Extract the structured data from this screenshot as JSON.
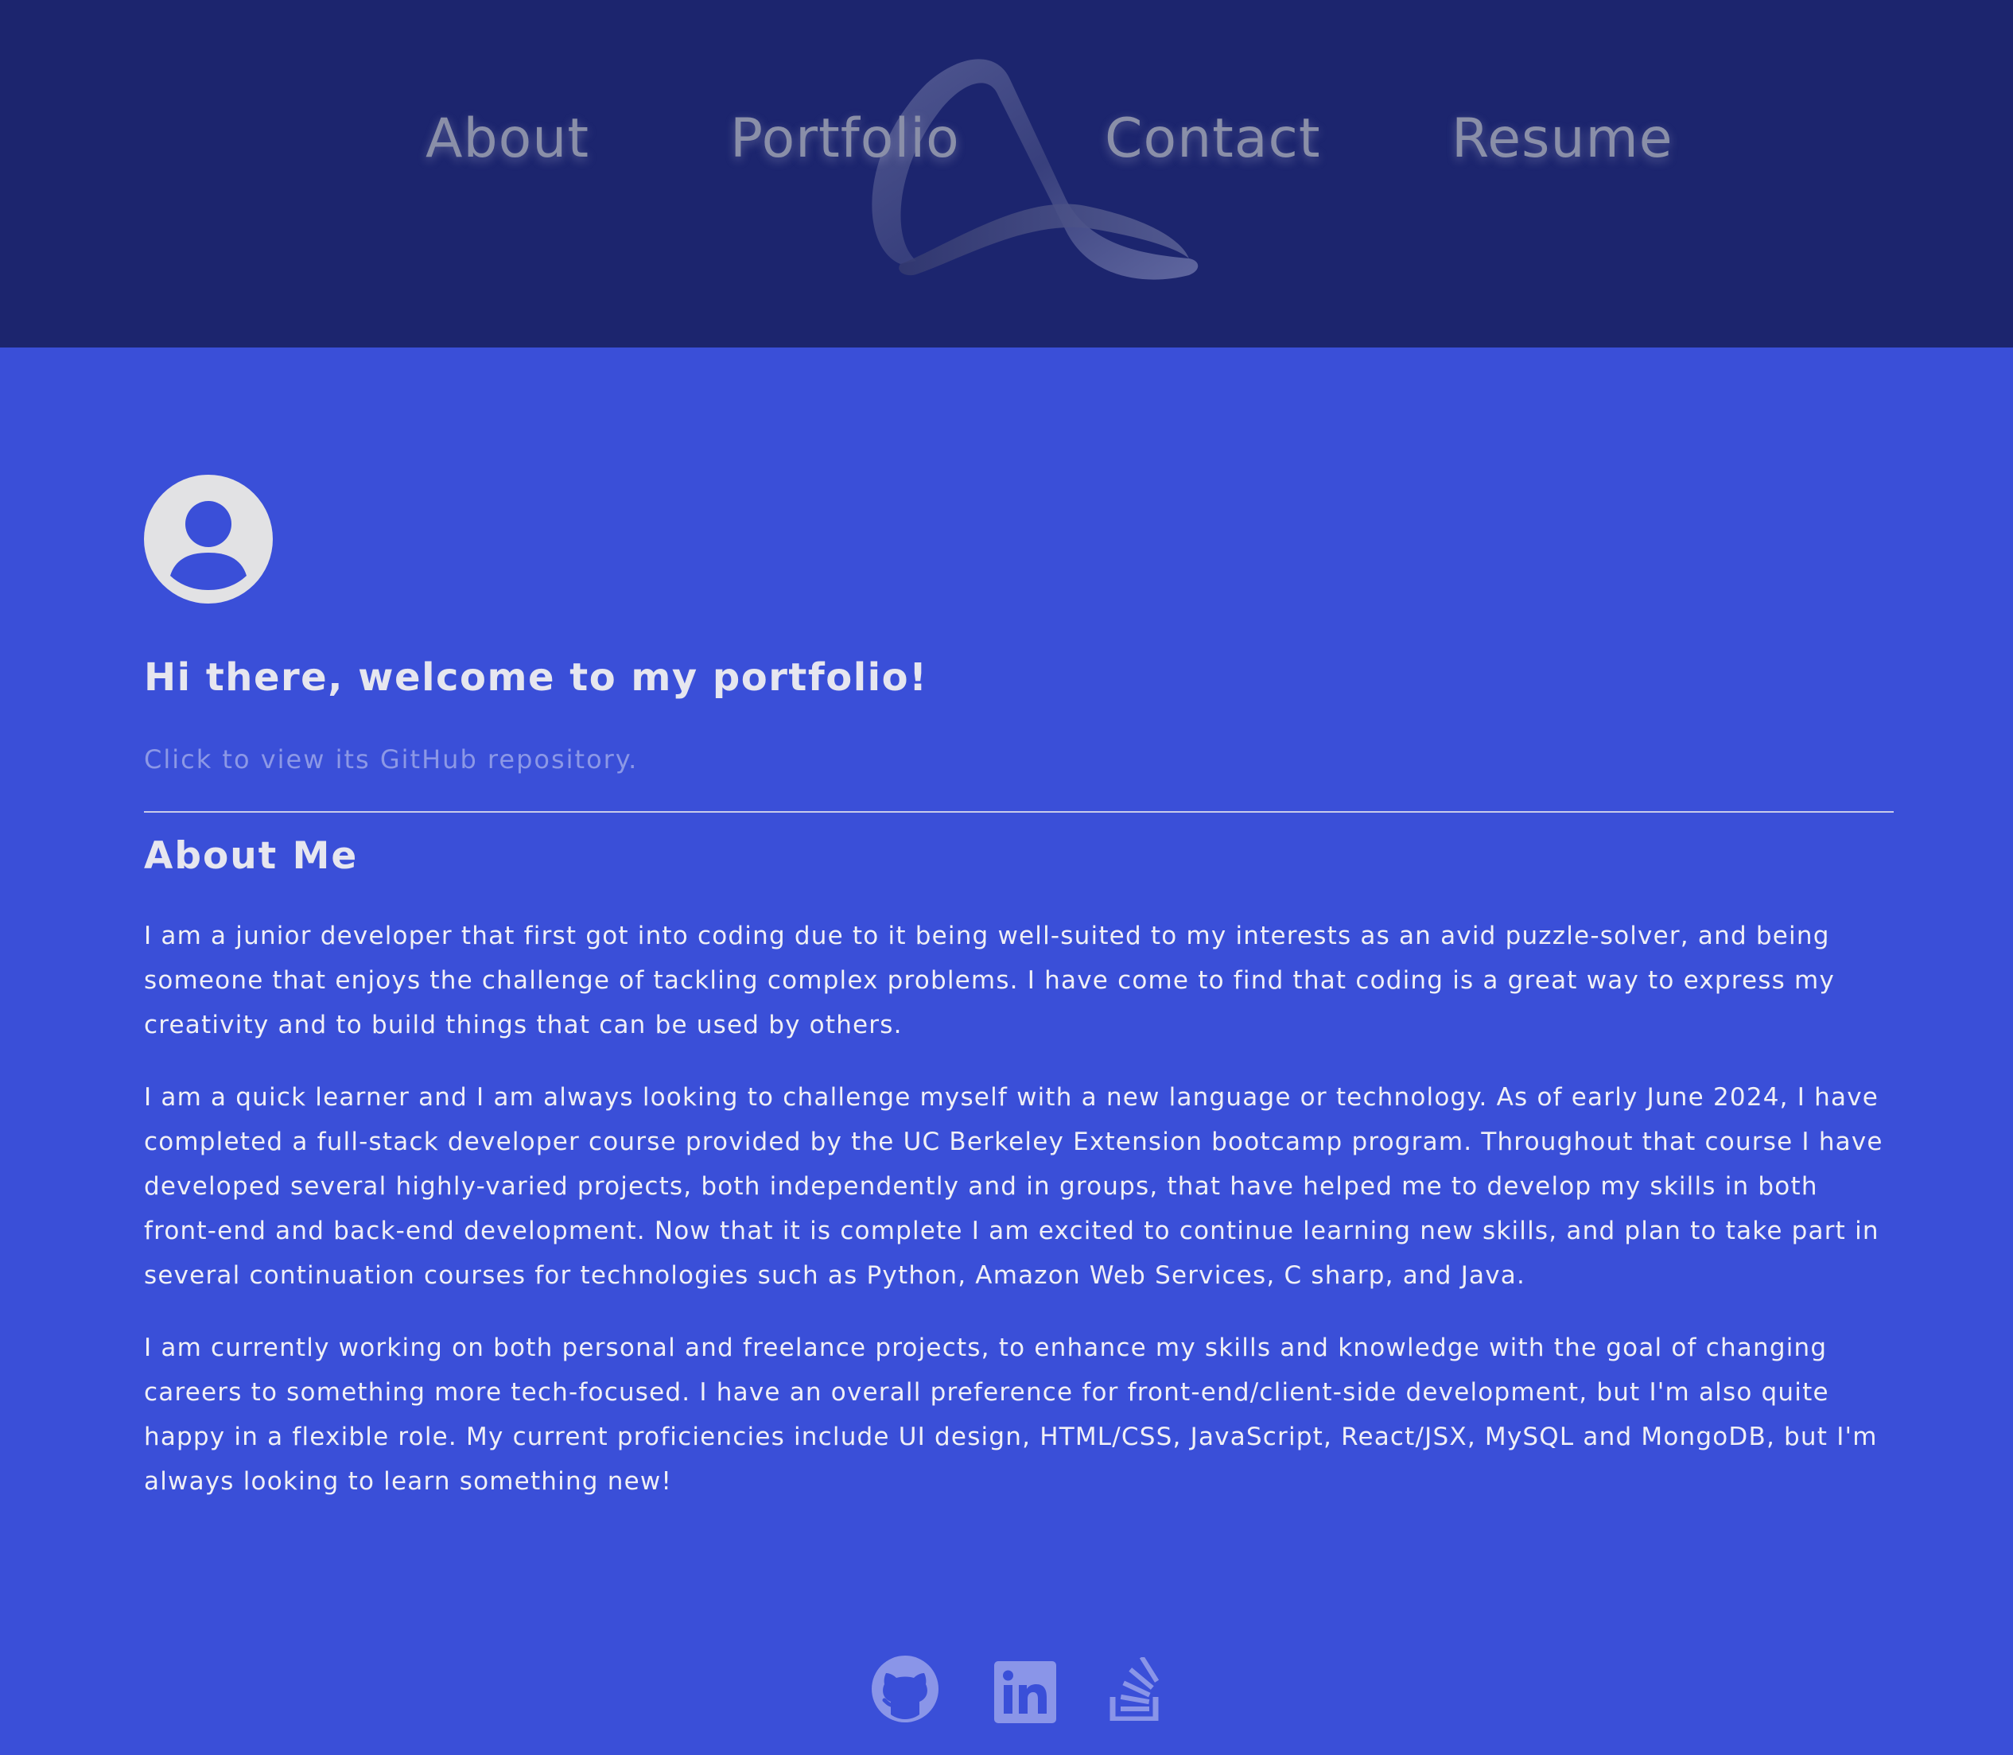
{
  "nav": {
    "items": [
      {
        "label": "About"
      },
      {
        "label": "Portfolio"
      },
      {
        "label": "Contact"
      },
      {
        "label": "Resume"
      }
    ]
  },
  "hero": {
    "title": "Hi there, welcome to my portfolio!",
    "repo_link": "Click to view its GitHub repository."
  },
  "about": {
    "heading": "About Me",
    "paragraphs": [
      "I am a junior developer that first got into coding due to it being well-suited to my interests as an avid puzzle-solver, and being someone that enjoys the challenge of tackling complex problems. I have come to find that coding is a great way to express my creativity and to build things that can be used by others.",
      "I am a quick learner and I am always looking to challenge myself with a new language or technology. As of early June 2024, I have completed a full-stack developer course provided by the UC Berkeley Extension bootcamp program. Throughout that course I have developed several highly-varied projects, both independently and in groups, that have helped me to develop my skills in both front-end and back-end development. Now that it is complete I am excited to continue learning new skills, and plan to take part in several continuation courses for technologies such as Python, Amazon Web Services, C sharp, and Java.",
      "I am currently working on both personal and freelance projects, to enhance my skills and knowledge with the goal of changing careers to something more tech-focused. I have an overall preference for front-end/client-side development, but I'm also quite happy in a flexible role. My current proficiencies include UI design, HTML/CSS, JavaScript, React/JSX, MySQL and MongoDB, but I'm always looking to learn something new!"
    ]
  },
  "social": {
    "icons": [
      "github-icon",
      "linkedin-icon",
      "stackoverflow-icon"
    ]
  },
  "colors": {
    "header_bg": "#1c256e",
    "page_bg": "#3a4fd8",
    "nav_text": "#8a8fa8",
    "heading_text": "#e6e6ef",
    "link_text": "#8c98e6",
    "social_icon": "#8a95e8"
  }
}
